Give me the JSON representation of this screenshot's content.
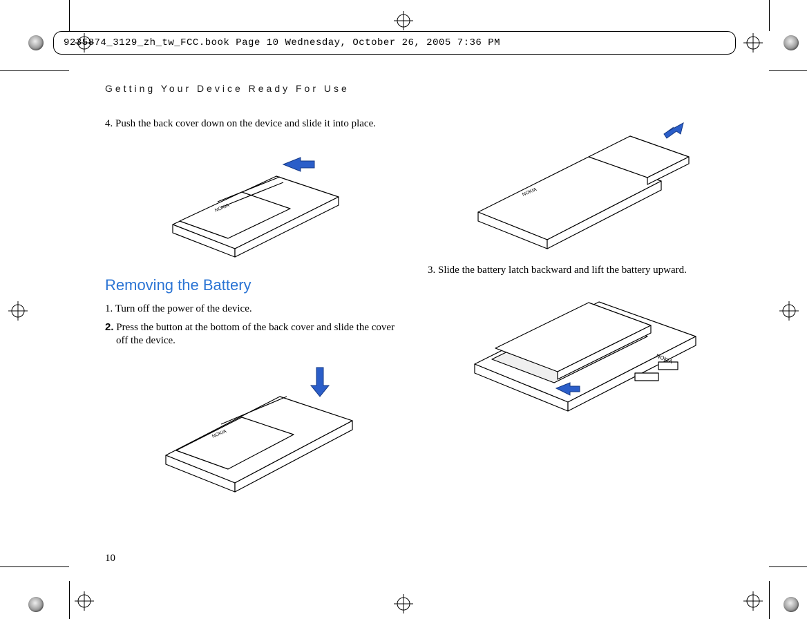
{
  "header_line": "9235874_3129_zh_tw_FCC.book  Page 10  Wednesday, October 26, 2005  7:36 PM",
  "section_header": "Getting Your Device Ready For Use",
  "left": {
    "step4": "4. Push the back cover down on the device and slide it into place.",
    "sub_heading": "Removing the Battery",
    "step1": "1. Turn off the power of the device.",
    "step2_num": "2.",
    "step2_text": " Press the button at the bottom of the back cover and slide the cover off the device."
  },
  "right": {
    "step3": "3. Slide the battery latch backward and lift the battery upward."
  },
  "page_number": "10"
}
